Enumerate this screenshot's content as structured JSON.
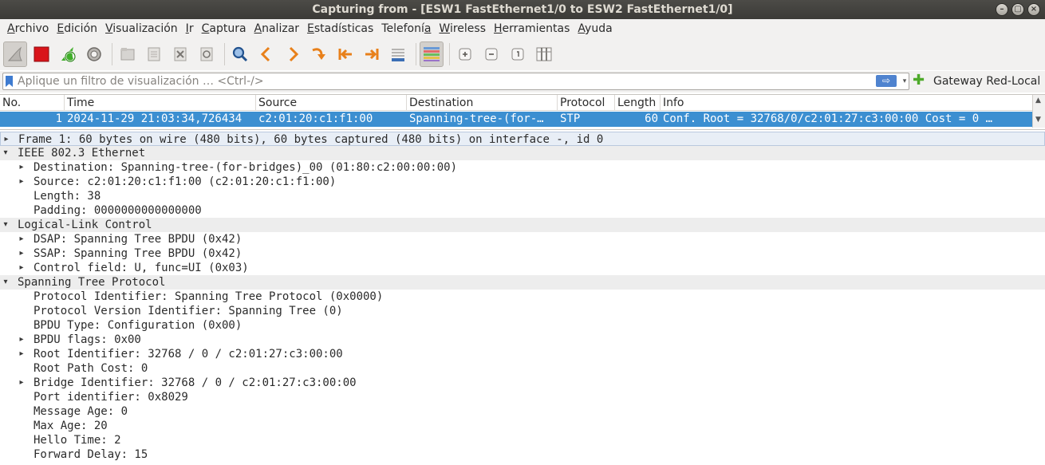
{
  "window": {
    "title": "Capturing from - [ESW1 FastEthernet1/0 to ESW2 FastEthernet1/0]",
    "controls": [
      "–",
      "▢",
      "×"
    ]
  },
  "menu": [
    "Archivo",
    "Edición",
    "Visualización",
    "Ir",
    "Captura",
    "Analizar",
    "Estadísticas",
    "Telefonía",
    "Wireless",
    "Herramientas",
    "Ayuda"
  ],
  "menu_underline_index": [
    0,
    0,
    0,
    0,
    0,
    0,
    0,
    8,
    0,
    0,
    0
  ],
  "toolbar_icons": [
    "shark-fin-icon",
    "stop-icon",
    "restart-icon",
    "gear-icon",
    "open-file-icon",
    "save-file-icon",
    "close-file-icon",
    "reload-icon",
    "search-icon",
    "back-icon",
    "forward-icon",
    "jump-icon",
    "first-packet-icon",
    "last-packet-icon",
    "autoscroll-icon",
    "colorize-icon",
    "zoom-in-icon",
    "zoom-out-icon",
    "zoom-reset-icon",
    "resize-columns-icon"
  ],
  "filter": {
    "placeholder": "Aplique un filtro de visualización … <Ctrl-/>",
    "value": "",
    "apply_glyph": "⇨",
    "dropdown_glyph": "▾",
    "add_glyph": "✚",
    "profile_button_label": "Gateway Red-Local"
  },
  "packet_list": {
    "columns": [
      "No.",
      "Time",
      "Source",
      "Destination",
      "Protocol",
      "Length",
      "Info"
    ],
    "rows": [
      {
        "no": "1",
        "time": "2024-11-29 21:03:34,726434",
        "source": "c2:01:20:c1:f1:00",
        "destination": "Spanning-tree-(for-…",
        "protocol": "STP",
        "length": "60",
        "info": "Conf. Root = 32768/0/c2:01:27:c3:00:00  Cost = 0  …"
      }
    ]
  },
  "details": [
    {
      "text": "Frame 1: 60 bytes on wire (480 bits), 60 bytes captured (480 bits) on interface -, id 0",
      "level": 0,
      "arrow": "▸"
    },
    {
      "text": "IEEE 802.3 Ethernet",
      "level": 0,
      "arrow": "▾"
    },
    {
      "text": "Destination: Spanning-tree-(for-bridges)_00 (01:80:c2:00:00:00)",
      "level": 1,
      "arrow": "▸"
    },
    {
      "text": "Source: c2:01:20:c1:f1:00 (c2:01:20:c1:f1:00)",
      "level": 1,
      "arrow": "▸"
    },
    {
      "text": "Length: 38",
      "level": 1,
      "arrow": ""
    },
    {
      "text": "Padding: 0000000000000000",
      "level": 1,
      "arrow": ""
    },
    {
      "text": "Logical-Link Control",
      "level": 0,
      "arrow": "▾"
    },
    {
      "text": "DSAP: Spanning Tree BPDU (0x42)",
      "level": 1,
      "arrow": "▸"
    },
    {
      "text": "SSAP: Spanning Tree BPDU (0x42)",
      "level": 1,
      "arrow": "▸"
    },
    {
      "text": "Control field: U, func=UI (0x03)",
      "level": 1,
      "arrow": "▸"
    },
    {
      "text": "Spanning Tree Protocol",
      "level": 0,
      "arrow": "▾"
    },
    {
      "text": "Protocol Identifier: Spanning Tree Protocol (0x0000)",
      "level": 1,
      "arrow": ""
    },
    {
      "text": "Protocol Version Identifier: Spanning Tree (0)",
      "level": 1,
      "arrow": ""
    },
    {
      "text": "BPDU Type: Configuration (0x00)",
      "level": 1,
      "arrow": ""
    },
    {
      "text": "BPDU flags: 0x00",
      "level": 1,
      "arrow": "▸"
    },
    {
      "text": "Root Identifier: 32768 / 0 / c2:01:27:c3:00:00",
      "level": 1,
      "arrow": "▸"
    },
    {
      "text": "Root Path Cost: 0",
      "level": 1,
      "arrow": ""
    },
    {
      "text": "Bridge Identifier: 32768 / 0 / c2:01:27:c3:00:00",
      "level": 1,
      "arrow": "▸"
    },
    {
      "text": "Port identifier: 0x8029",
      "level": 1,
      "arrow": ""
    },
    {
      "text": "Message Age: 0",
      "level": 1,
      "arrow": ""
    },
    {
      "text": "Max Age: 20",
      "level": 1,
      "arrow": ""
    },
    {
      "text": "Hello Time: 2",
      "level": 1,
      "arrow": ""
    },
    {
      "text": "Forward Delay: 15",
      "level": 1,
      "arrow": ""
    }
  ],
  "colors": {
    "selected_row": "#3c8fd1",
    "header_row": "#ededed",
    "stop": "#d9141a",
    "restart": "#3fae29"
  }
}
